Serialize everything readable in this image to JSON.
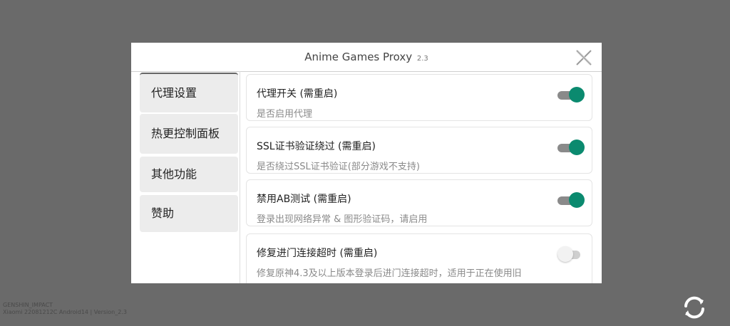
{
  "dialog": {
    "title": "Anime Games Proxy",
    "version": "2.3"
  },
  "sidebar": {
    "items": [
      {
        "label": "代理设置",
        "active": true
      },
      {
        "label": "热更控制面板",
        "active": false
      },
      {
        "label": "其他功能",
        "active": false
      },
      {
        "label": "赞助",
        "active": false
      }
    ]
  },
  "settings": [
    {
      "title": "代理开关 (需重启)",
      "desc": "是否启用代理",
      "enabled": true
    },
    {
      "title": "SSL证书验证绕过 (需重启)",
      "desc": "是否绕过SSL证书验证(部分游戏不支持)",
      "enabled": true
    },
    {
      "title": "禁用AB测试 (需重启)",
      "desc": "登录出现网络异常 & 图形验证码，请启用",
      "enabled": true
    },
    {
      "title": "修复进门连接超时 (需重启)",
      "desc": "修复原神4.3及以上版本登录后进门连接超时，适用于正在使用旧",
      "enabled": false
    }
  ],
  "footer": {
    "game": "GENSHIN_IMPACT",
    "device": "Xiaomi 22081212C Android14 | Version_2.3"
  },
  "colors": {
    "toggle_on": "#0b8a6f",
    "background": "#6a6a6a"
  },
  "icons": {
    "close": "close-icon",
    "refresh": "refresh-icon"
  }
}
